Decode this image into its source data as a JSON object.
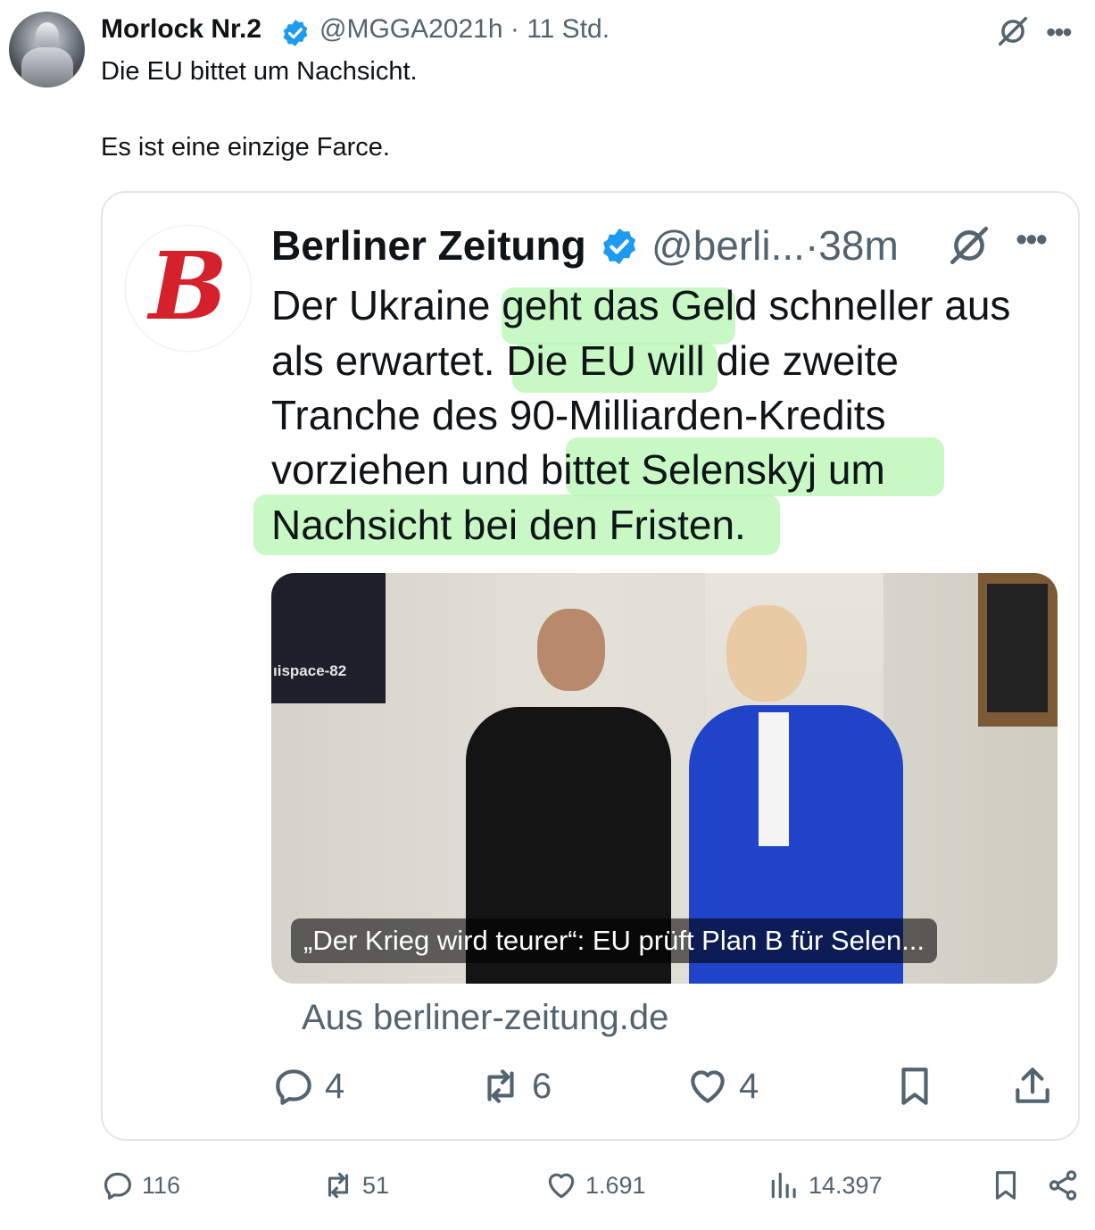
{
  "tweet": {
    "author_name": "Morlock Nr.2",
    "author_handle": "@MGGA2021h · 11 Std.",
    "text_line1": "Die EU bittet um Nachsicht.",
    "text_line2": "Es ist eine einzige Farce."
  },
  "quote": {
    "logo_letter": "B",
    "author_name": "Berliner Zeitung",
    "author_handle": "@berli...·38m",
    "lines": [
      "Der Ukraine geht das Geld schneller aus",
      "als erwartet. Die EU will die zweite",
      "Tranche des 90-Milliarden-Kredits",
      "vorziehen und bittet Selenskyj um",
      "Nachsicht bei den Fristen."
    ],
    "image_caption": "„Der Krieg wird teurer“: EU prüft Plan B für Selen...",
    "poster_text": "ıispace-82",
    "source": "Aus berliner-zeitung.de",
    "actions": {
      "replies": "4",
      "reposts": "6",
      "likes": "4"
    }
  },
  "actions": {
    "replies": "116",
    "reposts": "51",
    "likes": "1.691",
    "views": "14.397"
  },
  "colors": {
    "verified": "#1d9bf0",
    "logo_red": "#d4212b",
    "highlight": "#b6f5b0",
    "muted": "#536471"
  }
}
